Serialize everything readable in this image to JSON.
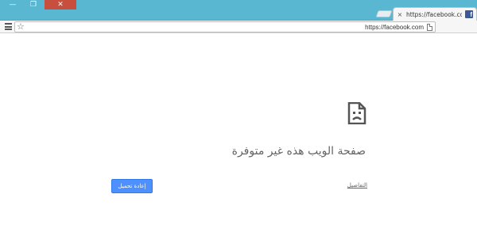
{
  "window": {
    "buttons": {
      "minimize": "—",
      "maximize": "❐",
      "close": "✕"
    }
  },
  "tab": {
    "title": "https://facebook.com/ :تر",
    "close_icon": "×",
    "favicon": "f",
    "favicon_color": "#3b5998"
  },
  "toolbar": {
    "menu_icon": "hamburger-icon",
    "star_icon": "☆",
    "url": "https://facebook.com"
  },
  "error_page": {
    "icon": "sad-document-icon",
    "title": "صفحة الويب هذه غير متوفرة",
    "reload_label": "إعادة تحميل",
    "details_label": "التفاصيل",
    "accent_color": "#4d90fe"
  }
}
